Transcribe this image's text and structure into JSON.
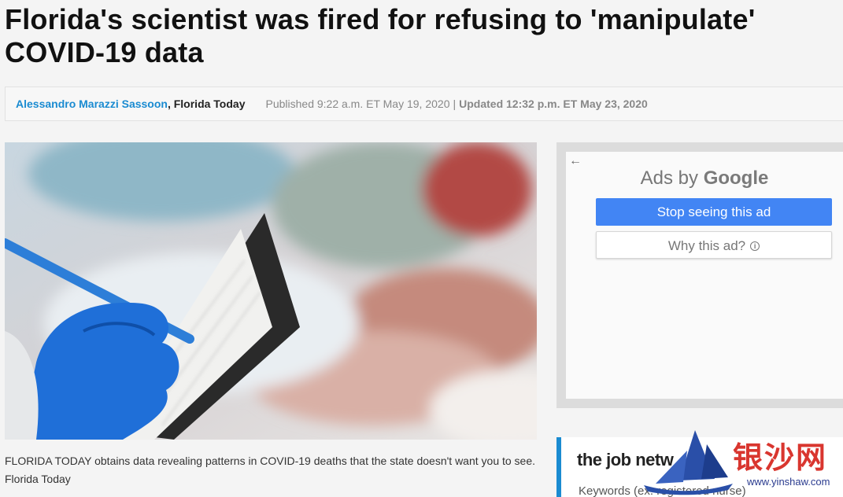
{
  "article": {
    "headline_line1": "Florida's scientist was fired for refusing to 'manipulate'",
    "headline_line2": "COVID-19 data",
    "byline": {
      "author": "Alessandro Marazzi Sassoon",
      "separator": ",",
      "outlet": "Florida Today",
      "published": "Published 9:22 a.m. ET May 19, 2020",
      "pipe": "|",
      "updated": "Updated 12:32 p.m. ET May 23, 2020"
    },
    "caption": "FLORIDA TODAY obtains data revealing patterns in COVID-19 deaths that the state doesn't want you to see. Florida Today"
  },
  "ad": {
    "back_icon": "back-arrow-icon",
    "ads_by": "Ads by",
    "google": "Google",
    "stop_label": "Stop seeing this ad",
    "why_label": "Why this ad?",
    "info_glyph": "i"
  },
  "job_network": {
    "logo_the": "the",
    "logo_rest": " job netw",
    "keywords_placeholder": "Keywords (ex. registered nurse)"
  },
  "watermark": {
    "chars": "银沙网",
    "url": "www.yinshaw.com"
  },
  "colors": {
    "accent_blue": "#1a8bd1",
    "google_blue": "#4285f4",
    "glove_blue": "#1f6fd8",
    "watermark_red": "#d9362f"
  }
}
